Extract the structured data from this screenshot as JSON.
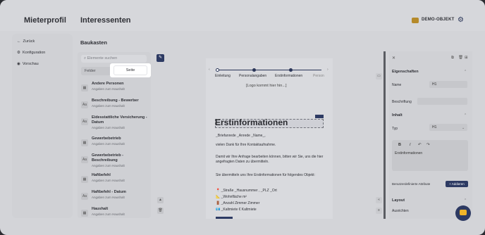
{
  "app": {
    "brand": "Mieterprofil",
    "page_title": "Interessenten",
    "object_label": "DEMO-OBJEKT"
  },
  "nav": {
    "back": "Zurück",
    "config": "Konfiguration",
    "preview": "Vorschau"
  },
  "builder": {
    "title": "Baukasten",
    "search_placeholder": "Elemente suchen",
    "tabs": [
      "Felder",
      "Seite"
    ],
    "active_tab": "Seite",
    "elements": [
      {
        "name": "Andere Personen",
        "sub": "Angaben zum Haushalt",
        "icon": "grid"
      },
      {
        "name": "Beschreibung - Bewerber",
        "sub": "Angaben zum Haushalt",
        "icon": "Aa"
      },
      {
        "name": "Eidesstattliche Versicherung - Datum",
        "sub": "Angaben zum Haushalt",
        "icon": "Aa"
      },
      {
        "name": "Gewerbebetrieb",
        "sub": "Angaben zum Haushalt",
        "icon": "grid"
      },
      {
        "name": "Gewerbebetrieb - Beschreibung",
        "sub": "Angaben zum Haushalt",
        "icon": "Aa"
      },
      {
        "name": "Haftbefehl",
        "sub": "Angaben zum Haushalt",
        "icon": "grid"
      },
      {
        "name": "Haftbefehl - Datum",
        "sub": "Angaben zum Haushalt",
        "icon": "Aa"
      },
      {
        "name": "Haushalt",
        "sub": "Angaben zum Haushalt",
        "icon": "grid"
      }
    ]
  },
  "canvas": {
    "steps": [
      "Einleitung",
      "Personalangaben",
      "Erstinformationen",
      "Person"
    ],
    "logo_placeholder": "[Logo kommt hier hin...]",
    "heading": "Erstinformationen",
    "greeting": "_Briefanrede _Anrede _Name_,",
    "p1": "vielen Dank für Ihre Kontaktaufnahme.",
    "p2": "Damit wir Ihre Anfrage bearbeiten können, bitten wir Sie, uns die hier angefragten Daten zu übermitteln.",
    "p3": "Sie übermitteln uns Ihre Erstinformationen für folgendes Objekt:",
    "address": "_Straße _Hausnummer , _PLZ _Ort",
    "area": "_Wohnfläche m²",
    "rooms": "_Anzahl Zimmer Zimmer",
    "rent": "_Kaltmiete € Kaltmiete"
  },
  "props": {
    "properties_title": "Eigenschaften",
    "name_label": "Name",
    "name_value": "H1",
    "label_label": "Beschriftung",
    "content_title": "Inhalt",
    "type_label": "Typ",
    "type_value": "H1",
    "rte_text": "Erstinformationen",
    "custom_attrs_label": "Benutzerdefinierte Attribute",
    "add_label": "+ Addieren",
    "layout_title": "Layout",
    "align_label": "Ausrichten"
  },
  "colors": {
    "accent": "#2d3a63",
    "spotlight": "#ffffff"
  }
}
